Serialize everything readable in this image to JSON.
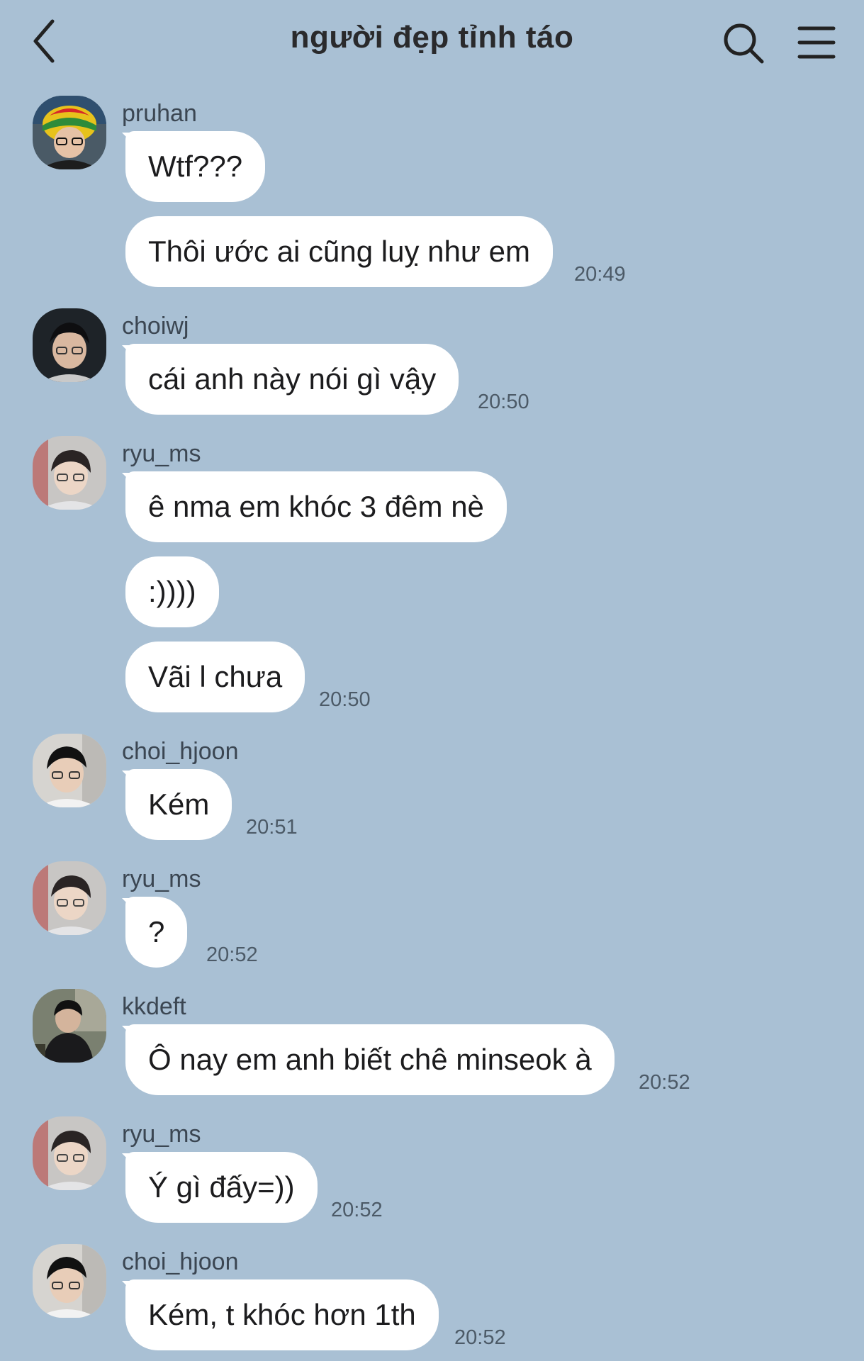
{
  "header": {
    "title": "người đẹp tỉnh táo",
    "back_icon": "chevron-left-icon",
    "search_icon": "search-icon",
    "menu_icon": "menu-icon"
  },
  "colors": {
    "background": "#a9c0d4",
    "bubble": "#ffffff",
    "text": "#1c1c1e",
    "meta": "#4c5a67"
  },
  "messages": [
    {
      "sender": "pruhan",
      "avatar": "avatar-pruhan",
      "bubbles": [
        {
          "text": "Wtf???",
          "time": ""
        },
        {
          "text": "Thôi ước ai cũng luỵ như em",
          "time": "20:49"
        }
      ]
    },
    {
      "sender": "choiwj",
      "avatar": "avatar-choiwj",
      "bubbles": [
        {
          "text": "cái anh này nói gì vậy",
          "time": "20:50"
        }
      ]
    },
    {
      "sender": "ryu_ms",
      "avatar": "avatar-ryu-ms",
      "bubbles": [
        {
          "text": "ê nma em khóc 3 đêm nè",
          "time": ""
        },
        {
          "text": ":))))",
          "time": ""
        },
        {
          "text": "Vãi l chưa",
          "time": "20:50"
        }
      ]
    },
    {
      "sender": "choi_hjoon",
      "avatar": "avatar-choi-hjoon",
      "bubbles": [
        {
          "text": "Kém",
          "time": "20:51"
        }
      ]
    },
    {
      "sender": "ryu_ms",
      "avatar": "avatar-ryu-ms",
      "bubbles": [
        {
          "text": "?",
          "time": "20:52"
        }
      ]
    },
    {
      "sender": "kkdeft",
      "avatar": "avatar-kkdeft",
      "bubbles": [
        {
          "text": "Ô nay em anh biết chê minseok à",
          "time": "20:52"
        }
      ]
    },
    {
      "sender": "ryu_ms",
      "avatar": "avatar-ryu-ms",
      "bubbles": [
        {
          "text": "Ý gì đấy=))",
          "time": "20:52"
        }
      ]
    },
    {
      "sender": "choi_hjoon",
      "avatar": "avatar-choi-hjoon",
      "bubbles": [
        {
          "text": "Kém, t khóc hơn 1th",
          "time": "20:52"
        }
      ]
    }
  ]
}
